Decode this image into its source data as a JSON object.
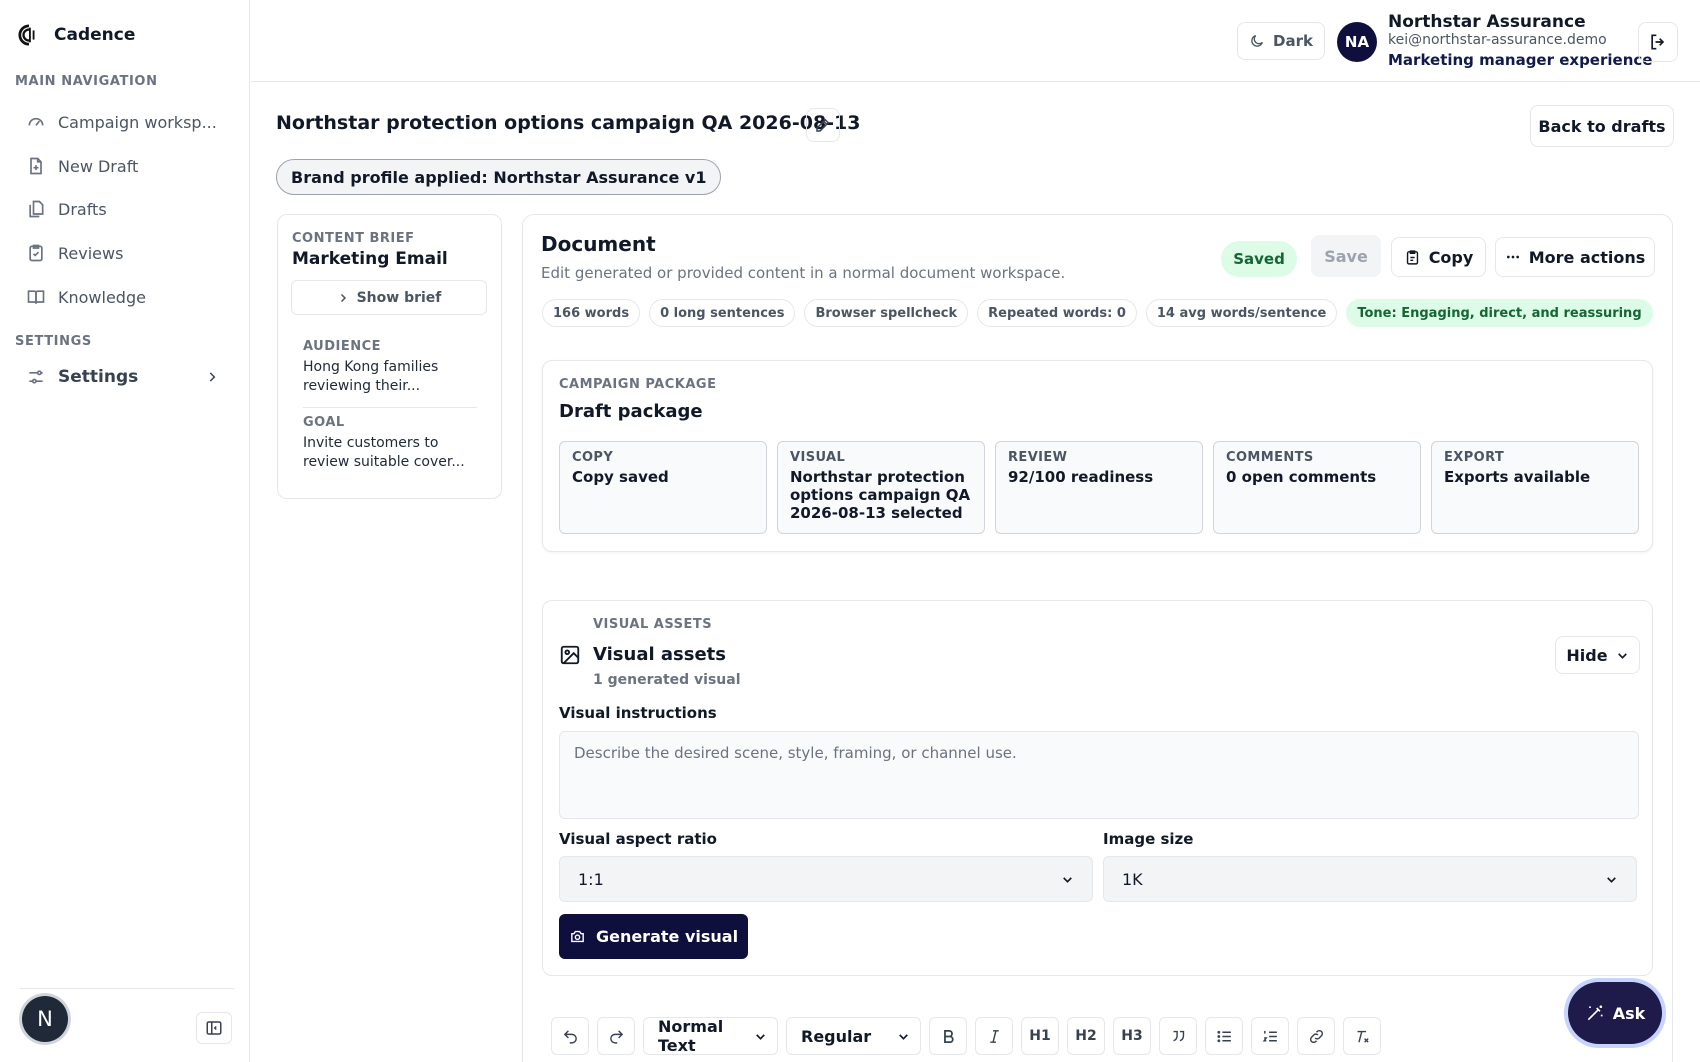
{
  "app": {
    "name": "Cadence"
  },
  "sidebar": {
    "main_heading": "MAIN NAVIGATION",
    "items": [
      {
        "label": "Campaign worksp...",
        "icon": "gauge-icon"
      },
      {
        "label": "New Draft",
        "icon": "file-plus-icon"
      },
      {
        "label": "Drafts",
        "icon": "files-icon"
      },
      {
        "label": "Reviews",
        "icon": "clipboard-check-icon"
      },
      {
        "label": "Knowledge",
        "icon": "book-icon"
      }
    ],
    "settings_heading": "SETTINGS",
    "settings_label": "Settings",
    "user_initial": "N"
  },
  "topbar": {
    "theme_label": "Dark",
    "user": {
      "initials": "NA",
      "name": "Northstar Assurance",
      "email": "kei@northstar-assurance.demo",
      "role": "Marketing manager experience"
    }
  },
  "page": {
    "title": "Northstar protection options campaign QA 2026-08-13",
    "back_label": "Back to drafts",
    "brand_pill": "Brand profile applied: Northstar Assurance v1"
  },
  "brief": {
    "caption": "CONTENT BRIEF",
    "title": "Marketing Email",
    "show_label": "Show brief",
    "audience_label": "AUDIENCE",
    "audience": "Hong Kong families reviewing their...",
    "goal_label": "GOAL",
    "goal": "Invite customers to review suitable cover..."
  },
  "document": {
    "title": "Document",
    "subtitle": "Edit generated or provided content in a normal document workspace.",
    "status": "Saved",
    "save_label": "Save",
    "copy_label": "Copy",
    "more_label": "More actions",
    "stats": [
      "166 words",
      "0 long sentences",
      "Browser spellcheck",
      "Repeated words: 0",
      "14 avg words/sentence"
    ],
    "tone": "Tone: Engaging, direct, and reassuring"
  },
  "package": {
    "caption": "CAMPAIGN PACKAGE",
    "title": "Draft package",
    "cards": [
      {
        "label": "COPY",
        "value": "Copy saved"
      },
      {
        "label": "VISUAL",
        "value": "Northstar protection options campaign QA 2026-08-13 selected"
      },
      {
        "label": "REVIEW",
        "value": "92/100 readiness"
      },
      {
        "label": "COMMENTS",
        "value": "0 open comments"
      },
      {
        "label": "EXPORT",
        "value": "Exports available"
      }
    ]
  },
  "visual": {
    "caption": "VISUAL ASSETS",
    "title": "Visual assets",
    "count": "1 generated visual",
    "hide_label": "Hide",
    "instructions_label": "Visual instructions",
    "instructions_placeholder": "Describe the desired scene, style, framing, or channel use.",
    "aspect_label": "Visual aspect ratio",
    "aspect_value": "1:1",
    "size_label": "Image size",
    "size_value": "1K",
    "generate_label": "Generate visual"
  },
  "editor": {
    "block_style": "Normal Text",
    "weight": "Regular",
    "h1": "H1",
    "h2": "H2",
    "h3": "H3"
  },
  "ask_label": "Ask",
  "colors": {
    "accent": "#0f0f3d",
    "success_bg": "#dcfce7",
    "success_text": "#166534"
  }
}
